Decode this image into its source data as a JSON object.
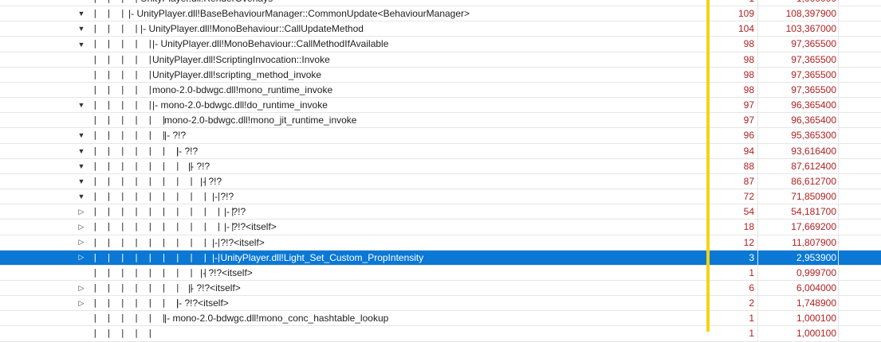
{
  "rows": [
    {
      "depth": 4,
      "toggle": "",
      "label": "UnityPlayer.dll!RenderOverlays",
      "c1": "1",
      "c2": "1,000000"
    },
    {
      "depth": 3,
      "toggle": "expanded",
      "label": "|- UnityPlayer.dll!BaseBehaviourManager::CommonUpdate<BehaviourManager>",
      "c1": "109",
      "c2": "108,397900"
    },
    {
      "depth": 4,
      "toggle": "expanded",
      "label": "|- UnityPlayer.dll!MonoBehaviour::CallUpdateMethod",
      "c1": "104",
      "c2": "103,367000"
    },
    {
      "depth": 5,
      "toggle": "expanded",
      "label": "|- UnityPlayer.dll!MonoBehaviour::CallMethodIfAvailable",
      "c1": "98",
      "c2": "97,365500"
    },
    {
      "depth": 5,
      "toggle": "",
      "label": "UnityPlayer.dll!ScriptingInvocation::Invoke",
      "c1": "98",
      "c2": "97,365500"
    },
    {
      "depth": 5,
      "toggle": "",
      "label": "UnityPlayer.dll!scripting_method_invoke",
      "c1": "98",
      "c2": "97,365500"
    },
    {
      "depth": 5,
      "toggle": "",
      "label": "mono-2.0-bdwgc.dll!mono_runtime_invoke",
      "c1": "98",
      "c2": "97,365500"
    },
    {
      "depth": 5,
      "toggle": "expanded",
      "label": "|- mono-2.0-bdwgc.dll!do_runtime_invoke",
      "c1": "97",
      "c2": "96,365400"
    },
    {
      "depth": 6,
      "toggle": "",
      "label": "mono-2.0-bdwgc.dll!mono_jit_runtime_invoke",
      "c1": "97",
      "c2": "96,365400"
    },
    {
      "depth": 6,
      "toggle": "expanded",
      "label": "|- ?!?",
      "c1": "96",
      "c2": "95,365300"
    },
    {
      "depth": 7,
      "toggle": "expanded",
      "label": "|- ?!?",
      "c1": "94",
      "c2": "93,616400"
    },
    {
      "depth": 8,
      "toggle": "expanded",
      "label": "|- ?!?",
      "c1": "88",
      "c2": "87,612400"
    },
    {
      "depth": 9,
      "toggle": "expanded",
      "label": "|- ?!?",
      "c1": "87",
      "c2": "86,612700"
    },
    {
      "depth": 10,
      "toggle": "expanded",
      "label": "|- ?!?",
      "c1": "72",
      "c2": "71,850900"
    },
    {
      "depth": 11,
      "toggle": "collapsed",
      "label": "|- ?!?",
      "c1": "54",
      "c2": "54,181700"
    },
    {
      "depth": 11,
      "toggle": "collapsed",
      "label": "|- ?!?<itself>",
      "c1": "18",
      "c2": "17,669200"
    },
    {
      "depth": 10,
      "toggle": "collapsed",
      "label": "|- ?!?<itself>",
      "c1": "12",
      "c2": "11,807900"
    },
    {
      "depth": 10,
      "toggle": "collapsed",
      "label": "|- UnityPlayer.dll!Light_Set_Custom_PropIntensity",
      "c1": "3",
      "c2": "2,953900",
      "selected": true
    },
    {
      "depth": 9,
      "toggle": "",
      "label": "|- ?!?<itself>",
      "c1": "1",
      "c2": "0,999700"
    },
    {
      "depth": 8,
      "toggle": "collapsed",
      "label": "|- ?!?<itself>",
      "c1": "6",
      "c2": "6,004000"
    },
    {
      "depth": 7,
      "toggle": "collapsed",
      "label": "|- ?!?<itself>",
      "c1": "2",
      "c2": "1,748900"
    },
    {
      "depth": 6,
      "toggle": "",
      "label": "|- mono-2.0-bdwgc.dll!mono_conc_hashtable_lookup",
      "c1": "1",
      "c2": "1,000100"
    },
    {
      "depth": 5,
      "toggle": "",
      "label": "",
      "c1": "1",
      "c2": "1,000100"
    }
  ],
  "colors": {
    "selection": "#0a78d4",
    "number": "#b02020",
    "highlight_bar": "#f7d117"
  },
  "icons": {
    "expanded": "triangle-down-icon",
    "collapsed": "triangle-right-icon"
  }
}
